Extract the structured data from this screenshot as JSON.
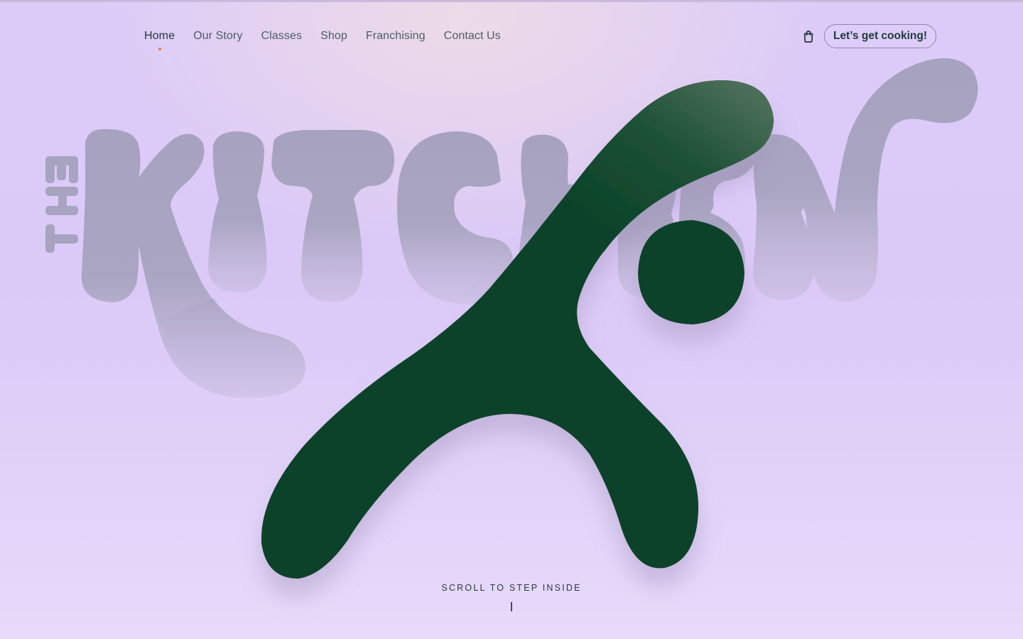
{
  "nav": {
    "items": [
      {
        "label": "Home",
        "active": true
      },
      {
        "label": "Our Story",
        "active": false
      },
      {
        "label": "Classes",
        "active": false
      },
      {
        "label": "Shop",
        "active": false
      },
      {
        "label": "Franchising",
        "active": false
      },
      {
        "label": "Contact Us",
        "active": false
      }
    ],
    "cart_icon": "shopping-bag-icon",
    "cta_label": "Let’s get cooking!"
  },
  "hero": {
    "wordmark_small": "THE",
    "wordmark_large": "KITCHEN",
    "scroll_label": "SCROLL TO STEP INSIDE"
  },
  "colors": {
    "background": "#dccbf8",
    "mascot_green": "#0b432a",
    "wordmark_gray": "#a5a0bd",
    "active_dot": "#f07a43",
    "text_dark": "#203940"
  }
}
